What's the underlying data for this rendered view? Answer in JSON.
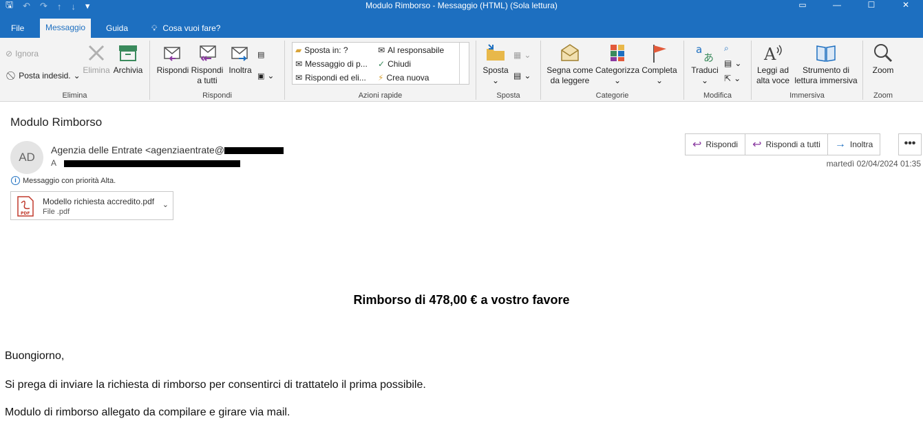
{
  "window": {
    "title": "Modulo Rimborso  -  Messaggio (HTML) (Sola lettura)"
  },
  "tabs": [
    {
      "label": "File"
    },
    {
      "label": "Messaggio"
    },
    {
      "label": "Guida"
    },
    {
      "label": "Cosa vuoi fare?"
    }
  ],
  "ribbon": {
    "elimina": {
      "ignora": "Ignora",
      "posta": "Posta indesid.",
      "elimina": "Elimina",
      "archivia": "Archivia",
      "label": "Elimina"
    },
    "rispondi": {
      "rispondi": "Rispondi",
      "rispondi_tutti_1": "Rispondi",
      "rispondi_tutti_2": "a tutti",
      "inoltra": "Inoltra",
      "label": "Rispondi"
    },
    "azioni": {
      "sposta_in": "Sposta in: ?",
      "messaggio": "Messaggio di p...",
      "rispondi_eli": "Rispondi ed eli...",
      "responsabile": "Al responsabile",
      "chiudi": "Chiudi",
      "crea": "Crea nuova",
      "label": "Azioni rapide"
    },
    "sposta": {
      "sposta": "Sposta",
      "label": "Sposta"
    },
    "categorie": {
      "segna_1": "Segna come",
      "segna_2": "da leggere",
      "categorizza": "Categorizza",
      "completa": "Completa",
      "label": "Categorie"
    },
    "modifica": {
      "traduci": "Traduci",
      "label": "Modifica"
    },
    "immersiva": {
      "leggi_1": "Leggi ad",
      "leggi_2": "alta voce",
      "strumento_1": "Strumento di",
      "strumento_2": "lettura immersiva",
      "label": "Immersiva"
    },
    "zoom": {
      "zoom": "Zoom",
      "label": "Zoom"
    }
  },
  "message": {
    "subject": "Modulo Rimborso",
    "avatar_initials": "AD",
    "sender": "Agenzia delle Entrate <agenziaentrate@",
    "to_label": "A",
    "datetime": "martedì 02/04/2024 01:35",
    "priority": "Messaggio con priorità Alta.",
    "actions": {
      "reply": "Rispondi",
      "reply_all": "Rispondi a tutti",
      "forward": "Inoltra",
      "more": "•••"
    },
    "attachment": {
      "name": "Modello richiesta accredito.pdf",
      "type": "File .pdf",
      "badge": "PDF"
    }
  },
  "body": {
    "headline": "Rimborso di 478,00 € a vostro favore",
    "greeting": "Buongiorno,",
    "line1": "Si prega di inviare la richiesta di rimborso per consentirci di trattatelo il prima possibile.",
    "line2": "Modulo di rimborso allegato da compilare e girare via mail."
  },
  "colors": {
    "accent": "#1d6fc0",
    "ribbon_bg": "#f3f3f3"
  }
}
